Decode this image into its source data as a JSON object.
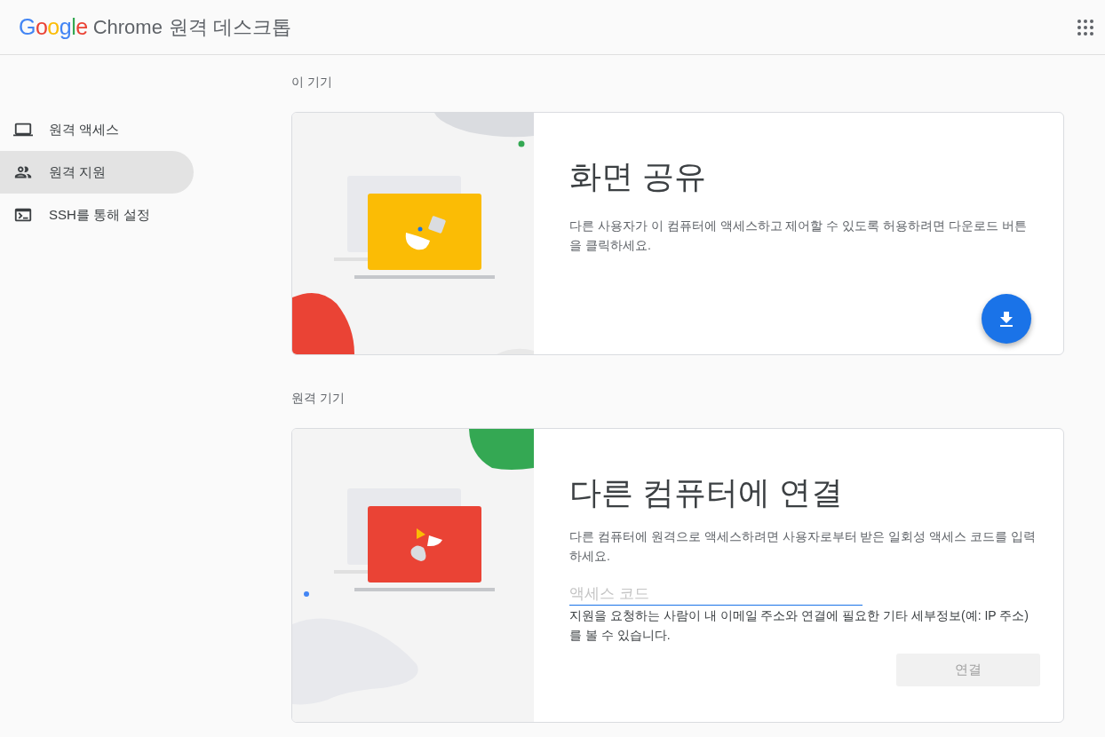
{
  "header": {
    "logo": "Google",
    "product": "Chrome",
    "title": "원격 데스크톱"
  },
  "sidebar": {
    "items": [
      {
        "label": "원격 액세스",
        "kind": "laptop",
        "selected": false
      },
      {
        "label": "원격 지원",
        "kind": "people",
        "selected": true
      },
      {
        "label": "SSH를 통해 설정",
        "kind": "terminal",
        "selected": false
      }
    ]
  },
  "sections": [
    {
      "heading": "이 기기",
      "kind": "share",
      "title": "화면 공유",
      "description": "다른 사용자가 이 컴퓨터에 액세스하고 제어할 수 있도록 허용하려면 다운로드 버튼을 클릭하세요."
    },
    {
      "heading": "원격 기기",
      "kind": "connect",
      "title": "다른 컴퓨터에 연결",
      "description": "다른 컴퓨터에 원격으로 액세스하려면 사용자로부터 받은 일회성 액세스 코드를 입력하세요.",
      "field": {
        "placeholder": "액세스 코드"
      },
      "hint": "지원을 요청하는 사람이 내 이메일 주소와 연결에 필요한 기타 세부정보(예: IP 주소)를 볼 수 있습니다.",
      "button": {
        "label": "연결",
        "disabled": true
      }
    }
  ]
}
